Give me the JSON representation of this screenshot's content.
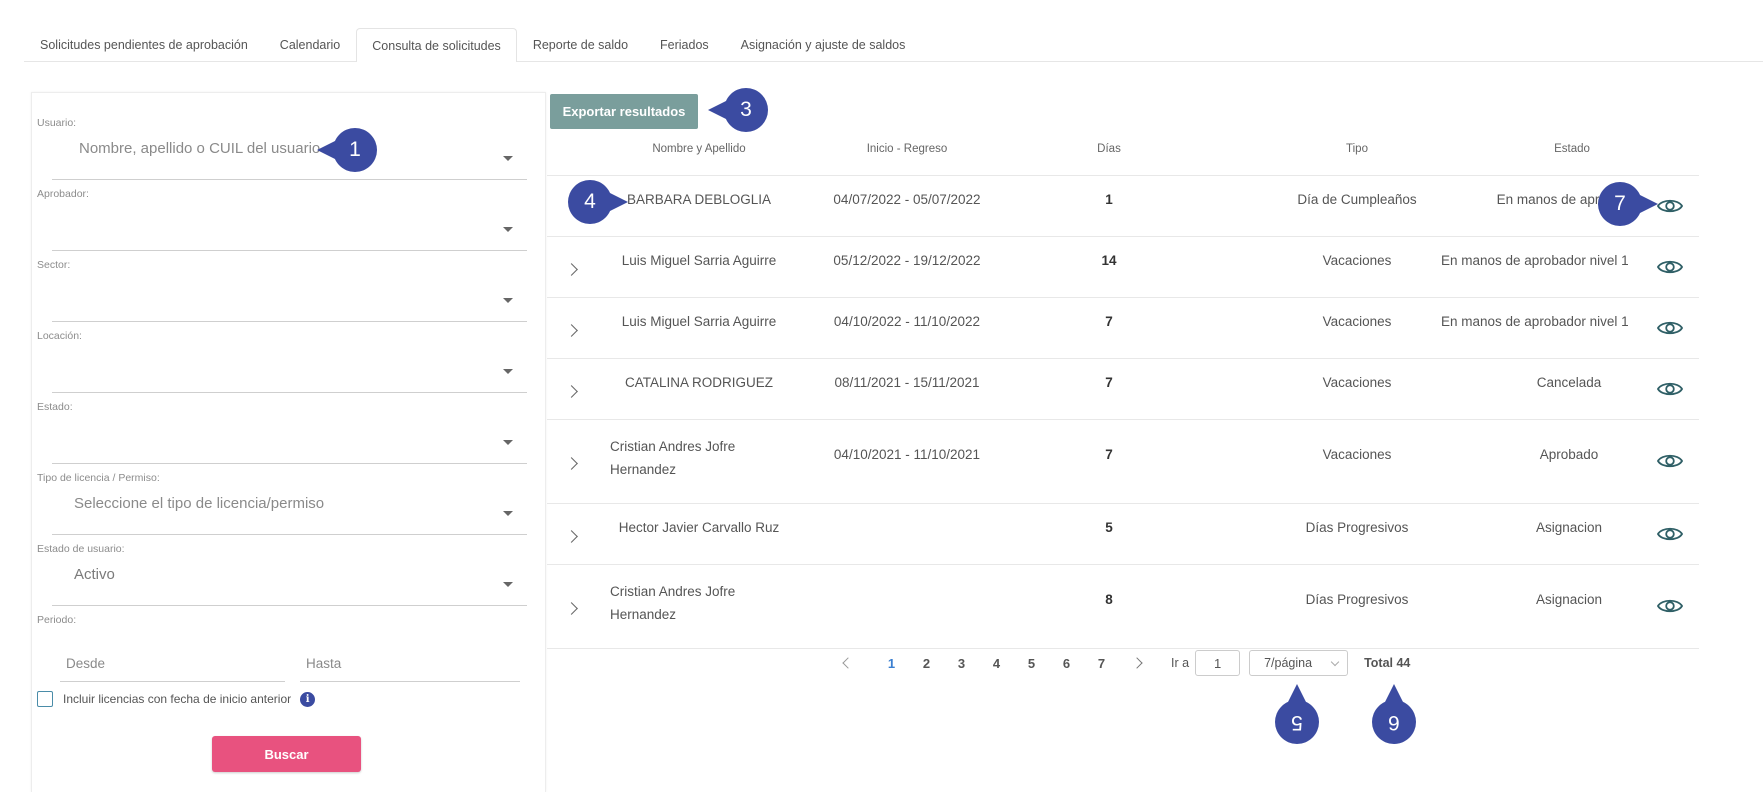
{
  "tabs": [
    {
      "label": "Solicitudes pendientes de aprobación",
      "active": false
    },
    {
      "label": "Calendario",
      "active": false
    },
    {
      "label": "Consulta de solicitudes",
      "active": true
    },
    {
      "label": "Reporte de saldo",
      "active": false
    },
    {
      "label": "Feriados",
      "active": false
    },
    {
      "label": "Asignación y ajuste de saldos",
      "active": false
    }
  ],
  "filters": {
    "usuario": {
      "label": "Usuario:",
      "placeholder": "Nombre, apellido o CUIL del usuario"
    },
    "aprobador": {
      "label": "Aprobador:",
      "value": ""
    },
    "sector": {
      "label": "Sector:",
      "value": ""
    },
    "locacion": {
      "label": "Locación:",
      "value": ""
    },
    "estado": {
      "label": "Estado:",
      "value": ""
    },
    "tipo": {
      "label": "Tipo de licencia / Permiso:",
      "placeholder": "Seleccione el tipo de licencia/permiso"
    },
    "estado_usuario": {
      "label": "Estado de usuario:",
      "value": "Activo"
    },
    "periodo": {
      "label": "Periodo:",
      "desde_placeholder": "Desde",
      "hasta_placeholder": "Hasta"
    },
    "checkbox_label": "Incluir licencias con fecha de inicio anterior",
    "info_icon_glyph": "i",
    "search_label": "Buscar"
  },
  "export_label": "Exportar resultados",
  "table": {
    "headers": [
      "Nombre y Apellido",
      "Inicio - Regreso",
      "Días",
      "Tipo",
      "Estado"
    ],
    "rows": [
      {
        "name": "BARBARA DEBLOGLIA",
        "dates": "04/07/2022 - 05/07/2022",
        "days": "1",
        "type": "Día de Cumpleaños",
        "status": "En manos de aprobador"
      },
      {
        "name": "Luis Miguel Sarria Aguirre",
        "dates": "05/12/2022 - 19/12/2022",
        "days": "14",
        "type": "Vacaciones",
        "status": "En manos de aprobador nivel 1"
      },
      {
        "name": "Luis Miguel Sarria Aguirre",
        "dates": "04/10/2022 - 11/10/2022",
        "days": "7",
        "type": "Vacaciones",
        "status": "En manos de aprobador nivel 1"
      },
      {
        "name": "CATALINA RODRIGUEZ",
        "dates": "08/11/2021 - 15/11/2021",
        "days": "7",
        "type": "Vacaciones",
        "status": "Cancelada"
      },
      {
        "name_line1": "Cristian Andres Jofre",
        "name_line2": "Hernandez",
        "dates": "04/10/2021 - 11/10/2021",
        "days": "7",
        "type": "Vacaciones",
        "status": "Aprobado"
      },
      {
        "name": "Hector Javier Carvallo Ruz",
        "dates": "",
        "days": "5",
        "type": "Días Progresivos",
        "status": "Asignacion"
      },
      {
        "name_line1": "Cristian Andres Jofre",
        "name_line2": "Hernandez",
        "dates": "",
        "days": "8",
        "type": "Días Progresivos",
        "status": "Asignacion"
      }
    ]
  },
  "pagination": {
    "pages": [
      "1",
      "2",
      "3",
      "4",
      "5",
      "6",
      "7"
    ],
    "current": "1",
    "goto_label": "Ir a",
    "goto_value": "1",
    "page_size": "7/página",
    "total": "Total 44"
  },
  "markers": [
    "1",
    "3",
    "4",
    "7",
    "5",
    "6"
  ],
  "colors": {
    "accent": "#e8527f",
    "export": "#7a9e9c",
    "marker": "#3b4ba1",
    "active_page": "#3a7fd0"
  }
}
